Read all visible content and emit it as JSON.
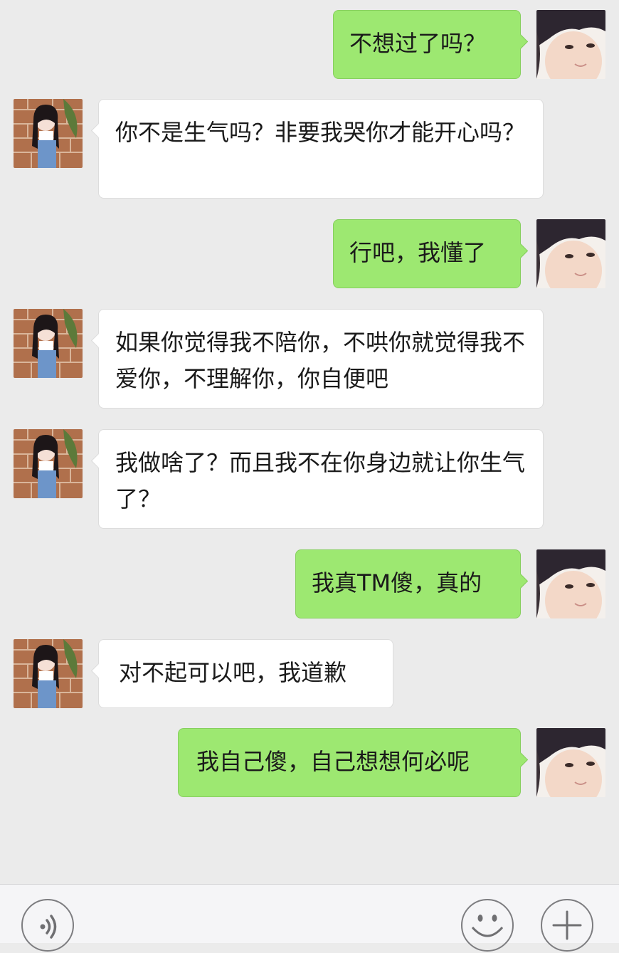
{
  "messages": [
    {
      "side": "right",
      "text": "不想过了吗？",
      "avatar": "boy-avatar"
    },
    {
      "side": "left",
      "text": "你不是生气吗？非要我哭你才能开心吗？",
      "avatar": "girl-avatar"
    },
    {
      "side": "right",
      "text": "行吧，我懂了",
      "avatar": "boy-avatar"
    },
    {
      "side": "left",
      "text": "如果你觉得我不陪你，不哄你就觉得我不爱你，不理解你，你自便吧",
      "avatar": "girl-avatar"
    },
    {
      "side": "left",
      "text": "我做啥了？而且我不在你身边就让你生气了？",
      "avatar": "girl-avatar"
    },
    {
      "side": "right",
      "text": "我真TM傻，真的",
      "avatar": "boy-avatar"
    },
    {
      "side": "left",
      "text": "对不起可以吧，我道歉",
      "avatar": "girl-avatar"
    },
    {
      "side": "right",
      "text": "我自己傻，自己想想何必呢",
      "avatar": "boy-avatar"
    }
  ],
  "input_bar": {
    "left_button_icon": "voice-icon",
    "right_buttons": [
      "emoji-icon",
      "plus-icon"
    ]
  },
  "colors": {
    "background": "#ebebeb",
    "sent_bubble": "#9de871",
    "received_bubble": "#ffffff"
  }
}
